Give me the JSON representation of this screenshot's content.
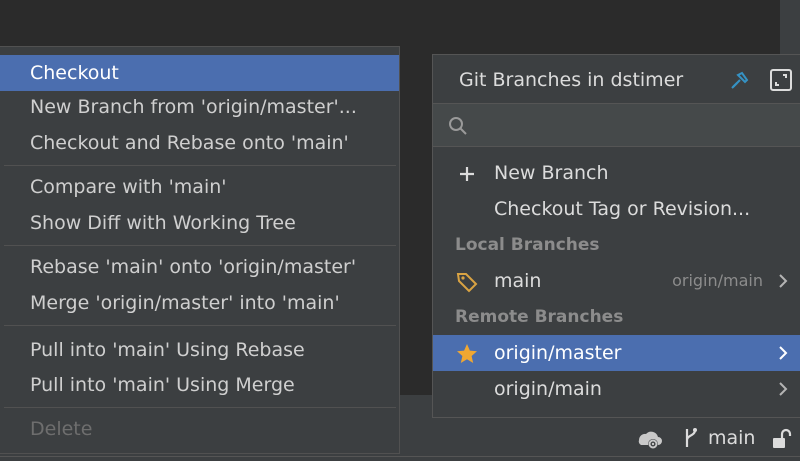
{
  "context_menu": {
    "items": [
      {
        "label": "Checkout",
        "state": "selected"
      },
      {
        "label": "New Branch from 'origin/master'...",
        "state": "normal"
      },
      {
        "label": "Checkout and Rebase onto 'main'",
        "state": "normal"
      },
      {
        "label": "Compare with 'main'",
        "state": "normal"
      },
      {
        "label": "Show Diff with Working Tree",
        "state": "normal"
      },
      {
        "label": "Rebase 'main' onto 'origin/master'",
        "state": "normal"
      },
      {
        "label": "Merge 'origin/master' into 'main'",
        "state": "normal"
      },
      {
        "label": "Pull into 'main' Using Rebase",
        "state": "normal"
      },
      {
        "label": "Pull into 'main' Using Merge",
        "state": "normal"
      },
      {
        "label": "Delete",
        "state": "disabled"
      }
    ]
  },
  "branches_popup": {
    "title": "Git Branches in dstimer",
    "search": {
      "value": "",
      "icon": "search-icon"
    },
    "actions": [
      {
        "label": "New Branch",
        "icon": "plus-icon"
      },
      {
        "label": "Checkout Tag or Revision...",
        "icon": ""
      }
    ],
    "local_header": "Local Branches",
    "local_branches": [
      {
        "label": "main",
        "tracking": "origin/main",
        "icon": "tag-icon"
      }
    ],
    "remote_header": "Remote Branches",
    "remote_branches": [
      {
        "label": "origin/master",
        "icon": "star-icon",
        "selected": true
      },
      {
        "label": "origin/main",
        "icon": "",
        "selected": false
      }
    ]
  },
  "status_bar": {
    "branch": "main"
  },
  "colors": {
    "selection": "#4b6eaf",
    "popup_bg": "#3c3f41",
    "star": "#f0a732",
    "tag": "#d9a343",
    "pin": "#3592c4"
  }
}
